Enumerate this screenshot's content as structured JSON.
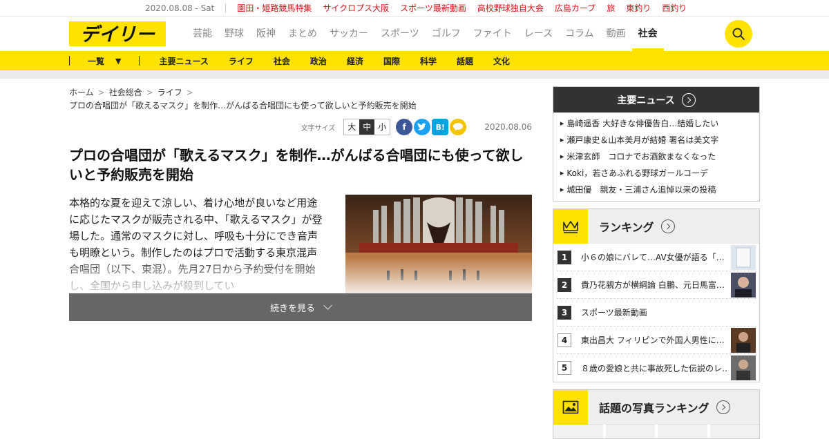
{
  "topbar": {
    "date": "2020.08.08 - Sat",
    "links": [
      "園田・姫路競馬特集",
      "サイクロプス大阪",
      "スポーツ最新動画",
      "高校野球独自大会",
      "広島カープ",
      "旅",
      "東釣り",
      "西釣り"
    ]
  },
  "header": {
    "logo_text": "デイリー",
    "nav": [
      "芸能",
      "野球",
      "阪神",
      "まとめ",
      "サッカー",
      "スポーツ",
      "ゴルフ",
      "ファイト",
      "レース",
      "コラム",
      "動画",
      "社会"
    ],
    "active_nav": "社会"
  },
  "subnav": {
    "all_label": "一覧",
    "categories": [
      "主要ニュース",
      "ライフ",
      "社会",
      "政治",
      "経済",
      "国際",
      "科学",
      "話題",
      "文化"
    ]
  },
  "breadcrumb": {
    "items": [
      "ホーム",
      "社会総合",
      "ライフ"
    ],
    "current": "プロの合唱団が「歌えるマスク」を制作…がんばる合唱団にも使って欲しいと予約販売を開始"
  },
  "meta": {
    "font_size_label": "文字サイズ",
    "font_sizes": [
      "大",
      "中",
      "小"
    ],
    "selected_font_size": "中",
    "date": "2020.08.06",
    "share": [
      "facebook",
      "twitter",
      "hatena",
      "line"
    ]
  },
  "article": {
    "title": "プロの合唱団が「歌えるマスク」を制作…がんばる合唱団にも使って欲しいと予約販売を開始",
    "lead": "本格的な夏を迎えて涼しい、着け心地が良いなど用途に応じたマスクが販売される中、「歌えるマスク」が登場した。通常のマスクに対し、呼吸も十分にでき音声も明瞭という。制作したのはプロで活動する東京混声合唱団（以下、東混）。先月27日から予約受付を開始し、全国から申し込みが殺到してい",
    "more_label": "続きを見る"
  },
  "sidebar": {
    "main_news": {
      "title": "主要ニュース",
      "items": [
        "島崎遥香 大好きな俳優告白…結婚したい",
        "瀬戸康史＆山本美月が結婚 署名は美文字",
        "米津玄師　コロナでお酒飲まなくなった",
        "Koki，若さあふれる野球ガールコーデ",
        "城田優　親友・三浦さん追悼以来の投稿"
      ]
    },
    "ranking": {
      "title": "ランキング",
      "items": [
        {
          "rank": "1",
          "text": "小６の娘にバレて…AV女優が語る「…"
        },
        {
          "rank": "2",
          "text": "貴乃花親方が横綱論 白鵬、元日馬富…"
        },
        {
          "rank": "3",
          "text": "スポーツ最新動画"
        },
        {
          "rank": "4",
          "text": "東出昌大 フィリピンで外国人男性に…"
        },
        {
          "rank": "5",
          "text": "８歳の愛娘と共に事故死した伝説のレ…"
        }
      ]
    },
    "photo_ranking": {
      "title": "話題の写真ランキング"
    }
  },
  "colors": {
    "brand_yellow": "#ffe200",
    "topbar_link_red": "#d7141a",
    "facebook": "#3b5998",
    "twitter": "#1da1f2",
    "hatena": "#00a4de",
    "comment": "#f5c400"
  }
}
